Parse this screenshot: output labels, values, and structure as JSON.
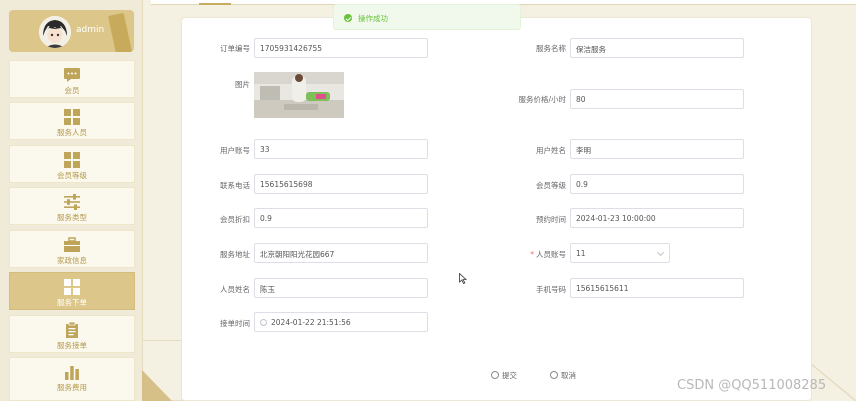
{
  "user": {
    "name": "admin"
  },
  "sidebar": {
    "items": [
      {
        "label": "会员",
        "icon": "chat-icon"
      },
      {
        "label": "服务人员",
        "icon": "grid-icon"
      },
      {
        "label": "会员等级",
        "icon": "grid-icon"
      },
      {
        "label": "服务类型",
        "icon": "sliders-icon"
      },
      {
        "label": "家政信息",
        "icon": "briefcase-icon"
      },
      {
        "label": "服务下单",
        "icon": "grid-icon",
        "active": true
      },
      {
        "label": "服务接单",
        "icon": "clipboard-icon"
      },
      {
        "label": "服务费用",
        "icon": "bar-chart-icon"
      }
    ]
  },
  "toast": {
    "message": "操作成功",
    "type": "success"
  },
  "form": {
    "order_no": {
      "label": "订单编号",
      "value": "1705931426755"
    },
    "service_name": {
      "label": "服务名称",
      "value": "保洁服务"
    },
    "image": {
      "label": "图片"
    },
    "price": {
      "label": "服务价格/小时",
      "value": "80"
    },
    "user_account": {
      "label": "用户账号",
      "value": "33"
    },
    "user_name": {
      "label": "用户姓名",
      "value": "李明"
    },
    "phone": {
      "label": "联系电话",
      "value": "15615615698"
    },
    "member_level": {
      "label": "会员等级",
      "value": "0.9"
    },
    "member_discount": {
      "label": "会员折扣",
      "value": "0.9"
    },
    "appointment_time": {
      "label": "预约时间",
      "value": "2024-01-23 10:00:00"
    },
    "address": {
      "label": "服务地址",
      "value": "北京朝阳阳光花园667"
    },
    "staff_account": {
      "label": "人员账号",
      "value": "11",
      "required": true
    },
    "staff_name": {
      "label": "人员姓名",
      "value": "陈玉"
    },
    "mobile": {
      "label": "手机号码",
      "value": "15615615611"
    },
    "accept_time": {
      "label": "接单时间",
      "value": "2024-01-22 21:51:56"
    }
  },
  "actions": {
    "submit": "提交",
    "cancel": "取消"
  },
  "watermark": "CSDN @QQ511008285",
  "colors": {
    "accent": "#dcc68a",
    "accent_text": "#b59a4c",
    "success": "#67c23a",
    "required": "#f56c6c"
  }
}
